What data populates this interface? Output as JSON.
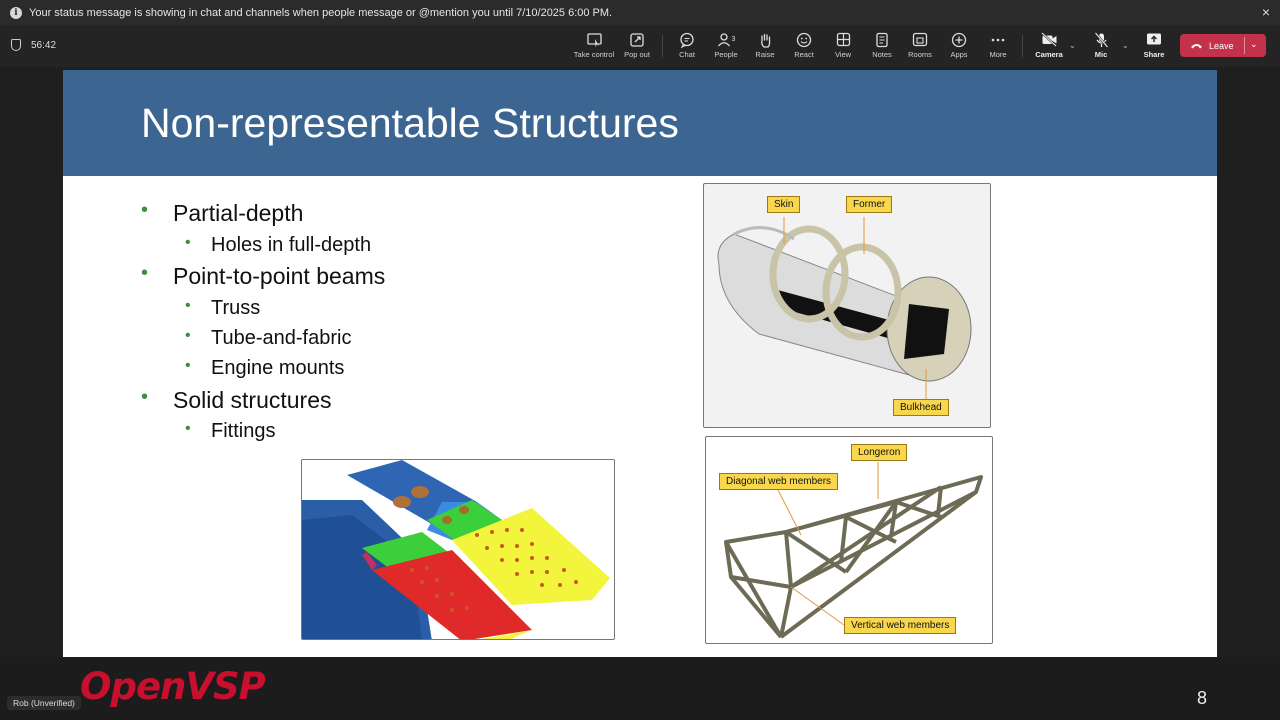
{
  "banner": {
    "message": "Your status message is showing in chat and channels when people message or @mention you until 7/10/2025 6:00 PM.",
    "close_icon": "×"
  },
  "meeting": {
    "timer": "56:42"
  },
  "toolbar": {
    "take_control": "Take control",
    "pop_out": "Pop out",
    "chat": "Chat",
    "people": "People",
    "people_count": "3",
    "raise": "Raise",
    "react": "React",
    "view": "View",
    "notes": "Notes",
    "rooms": "Rooms",
    "apps": "Apps",
    "more": "More",
    "camera": "Camera",
    "mic": "Mic",
    "share": "Share",
    "leave": "Leave"
  },
  "slide": {
    "title": "Non-representable Structures",
    "bullets": [
      {
        "text": "Partial-depth",
        "subs": [
          "Holes in full-depth"
        ]
      },
      {
        "text": "Point-to-point beams",
        "subs": [
          "Truss",
          "Tube-and-fabric",
          "Engine mounts"
        ]
      },
      {
        "text": "Solid structures",
        "subs": [
          "Fittings"
        ]
      }
    ],
    "fuselage_callouts": {
      "skin": "Skin",
      "former": "Former",
      "bulkhead": "Bulkhead"
    },
    "truss_callouts": {
      "longeron": "Longeron",
      "diagonal": "Diagonal web members",
      "vertical": "Vertical web members"
    },
    "page_number": "8"
  },
  "footer": {
    "logo": "OpenVSP",
    "participant": "Rob (Unverified)"
  },
  "colors": {
    "header": "#3d6592",
    "bullet": "#3d8c40",
    "leave": "#c4314b",
    "logo": "#c8102e",
    "callout": "#f9d74c"
  }
}
